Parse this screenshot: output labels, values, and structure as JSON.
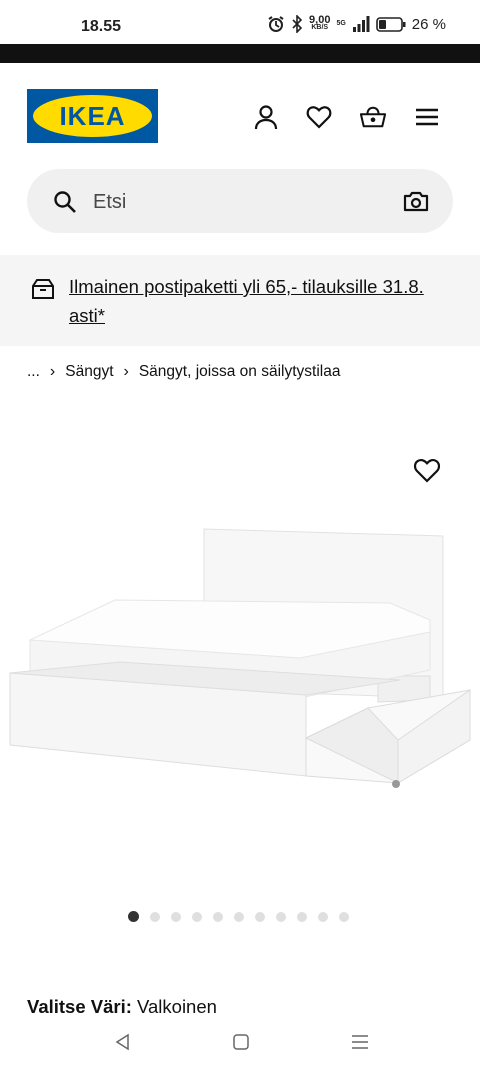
{
  "status": {
    "time": "18.55",
    "net_speed": "9,00",
    "net_unit": "KB/S",
    "network": "5G",
    "battery": "26 %"
  },
  "header": {
    "logo_text": "IKEA",
    "brand_blue": "#0058a3",
    "brand_yellow": "#ffdb00"
  },
  "icons": {
    "account": "person-icon",
    "wishlist": "heart-icon",
    "cart": "basket-icon",
    "menu": "hamburger-icon"
  },
  "search": {
    "placeholder": "Etsi"
  },
  "promo": {
    "text": "Ilmainen postipaketti yli 65,- tilauksille 31.8. asti*"
  },
  "breadcrumb": {
    "ellipsis": "...",
    "items": [
      "Sängyt",
      "Sängyt, joissa on säilytystilaa"
    ]
  },
  "gallery": {
    "image_count": 11,
    "active_index": 0
  },
  "color_select": {
    "label": "Valitse Väri:",
    "value": "Valkoinen"
  }
}
